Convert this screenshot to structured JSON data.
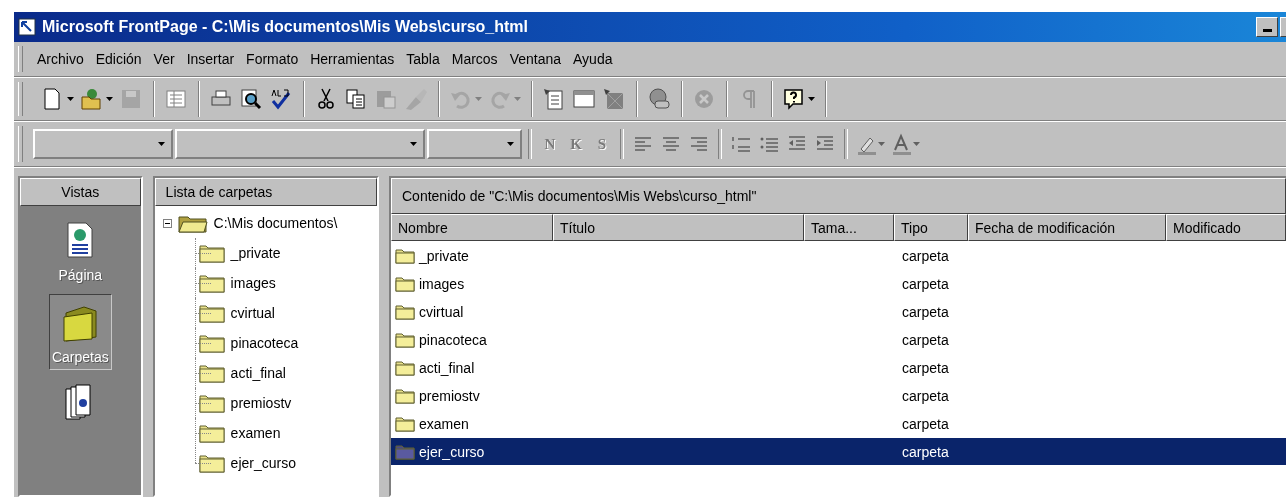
{
  "window": {
    "title": "Microsoft FrontPage - C:\\Mis documentos\\Mis Webs\\curso_html"
  },
  "menu": [
    "Archivo",
    "Edición",
    "Ver",
    "Insertar",
    "Formato",
    "Herramientas",
    "Tabla",
    "Marcos",
    "Ventana",
    "Ayuda"
  ],
  "standard_toolbar": [
    [
      {
        "kind": "split",
        "disabled": false
      },
      {
        "kind": "split",
        "disabled": false
      },
      {
        "kind": "button",
        "disabled": true
      }
    ],
    [
      {
        "kind": "button",
        "disabled": false
      }
    ],
    [
      {
        "kind": "button",
        "disabled": false
      },
      {
        "kind": "button",
        "disabled": false
      },
      {
        "kind": "button",
        "disabled": false
      }
    ],
    [
      {
        "kind": "button",
        "disabled": false
      },
      {
        "kind": "button",
        "disabled": false
      },
      {
        "kind": "button",
        "disabled": true
      },
      {
        "kind": "button",
        "disabled": true
      }
    ],
    [
      {
        "kind": "split",
        "disabled": true
      },
      {
        "kind": "split",
        "disabled": true
      }
    ],
    [
      {
        "kind": "button",
        "disabled": false
      },
      {
        "kind": "button",
        "disabled": false
      },
      {
        "kind": "button",
        "disabled": false
      }
    ],
    [
      {
        "kind": "button",
        "disabled": false
      }
    ],
    [
      {
        "kind": "button",
        "disabled": true
      }
    ],
    [
      {
        "kind": "button",
        "disabled": true
      }
    ],
    [
      {
        "kind": "menu",
        "disabled": false
      }
    ]
  ],
  "format_toolbar": {
    "style_box": {
      "kind": "combo"
    },
    "font_box": {
      "kind": "combo"
    },
    "size_box": {
      "kind": "combo"
    },
    "buttons": [
      {
        "kind": "letter",
        "label": "N",
        "disabled": true
      },
      {
        "kind": "letter",
        "label": "K",
        "disabled": true
      },
      {
        "kind": "letter",
        "label": "S",
        "disabled": true
      },
      {
        "kind": "separator"
      },
      {
        "kind": "align-left",
        "disabled": true
      },
      {
        "kind": "align-center",
        "disabled": true
      },
      {
        "kind": "align-right",
        "disabled": true
      },
      {
        "kind": "separator"
      },
      {
        "kind": "numbered-list",
        "disabled": true
      },
      {
        "kind": "bullet-list",
        "disabled": true
      },
      {
        "kind": "outdent",
        "disabled": true
      },
      {
        "kind": "indent",
        "disabled": true
      },
      {
        "kind": "separator"
      },
      {
        "kind": "highlight",
        "disabled": true
      },
      {
        "kind": "font-color",
        "disabled": true
      }
    ]
  },
  "views": {
    "title": "Vistas",
    "items": [
      {
        "label": "Página",
        "selected": false
      },
      {
        "label": "Carpetas",
        "selected": true
      },
      {
        "selected": false
      }
    ]
  },
  "folder_list": {
    "title": "Lista de carpetas",
    "root": {
      "label": "C:\\Mis documentos\\",
      "expanded": true,
      "children": [
        {
          "label": "_private"
        },
        {
          "label": "images"
        },
        {
          "label": "cvirtual"
        },
        {
          "label": "pinacoteca"
        },
        {
          "label": "acti_final"
        },
        {
          "label": "premiostv"
        },
        {
          "label": "examen"
        },
        {
          "label": "ejer_curso"
        }
      ]
    }
  },
  "contents": {
    "title": "Contenido de \"C:\\Mis documentos\\Mis Webs\\curso_html\"",
    "columns": [
      "Nombre",
      "Título",
      "Tama...",
      "Tipo",
      "Fecha de modificación",
      "Modificado"
    ],
    "rows": [
      {
        "name": "_private",
        "type": "carpeta",
        "selected": false
      },
      {
        "name": "images",
        "type": "carpeta",
        "selected": false
      },
      {
        "name": "cvirtual",
        "type": "carpeta",
        "selected": false
      },
      {
        "name": "pinacoteca",
        "type": "carpeta",
        "selected": false
      },
      {
        "name": "acti_final",
        "type": "carpeta",
        "selected": false
      },
      {
        "name": "premiostv",
        "type": "carpeta",
        "selected": false
      },
      {
        "name": "examen",
        "type": "carpeta",
        "selected": false
      },
      {
        "name": "ejer_curso",
        "type": "carpeta",
        "selected": true
      }
    ]
  }
}
